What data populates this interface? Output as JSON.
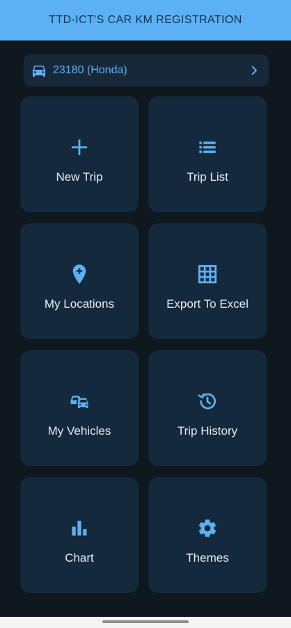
{
  "header": {
    "title": "TTD-ICT'S CAR KM REGISTRATION"
  },
  "vehicle": {
    "label": "23180 (Honda)",
    "icon": "car-icon"
  },
  "tiles": [
    {
      "label": "New Trip",
      "icon": "plus-icon"
    },
    {
      "label": "Trip List",
      "icon": "list-icon"
    },
    {
      "label": "My Locations",
      "icon": "add-location-icon"
    },
    {
      "label": "Export To Excel",
      "icon": "grid-icon"
    },
    {
      "label": "My Vehicles",
      "icon": "vehicles-icon"
    },
    {
      "label": "Trip History",
      "icon": "history-icon"
    },
    {
      "label": "Chart",
      "icon": "bar-chart-icon"
    },
    {
      "label": "Themes",
      "icon": "gear-icon"
    }
  ],
  "colors": {
    "accent": "#5cb1f5",
    "background": "#0f181e",
    "tile": "#14293b",
    "text": "#e8eef3"
  }
}
